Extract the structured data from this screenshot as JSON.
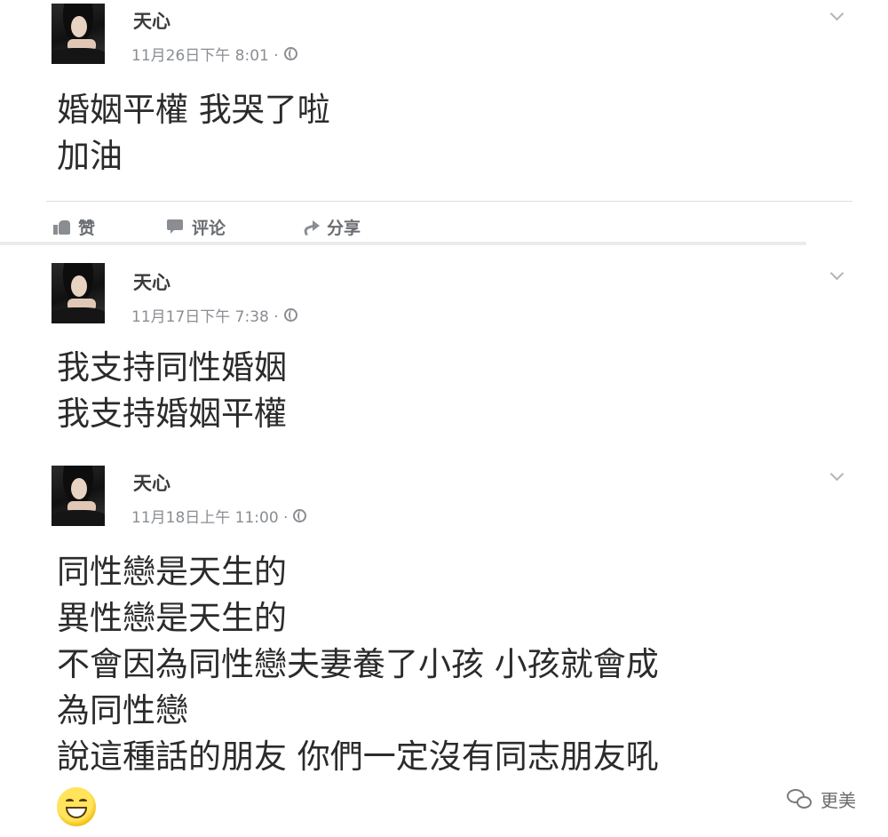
{
  "posts": [
    {
      "author": "天心",
      "timestamp": "11月26日下午 8:01 ·",
      "lines": [
        "婚姻平權 我哭了啦",
        "加油"
      ],
      "actions": {
        "like": "赞",
        "comment": "评论",
        "share": "分享"
      }
    },
    {
      "author": "天心",
      "timestamp": "11月17日下午 7:38 ·",
      "lines": [
        "我支持同性婚姻",
        "我支持婚姻平權"
      ]
    },
    {
      "author": "天心",
      "timestamp": "11月18日上午 11:00 ·",
      "lines": [
        "同性戀是天生的",
        "異性戀是天生的",
        "不會因為同性戀夫妻養了小孩 小孩就會成",
        "為同性戀",
        "說這種話的朋友 你們一定沒有同志朋友吼"
      ]
    }
  ],
  "watermark": {
    "text": "更美",
    "icon": "wechat-icon"
  },
  "icons": {
    "privacy": "globe-icon",
    "menu": "chevron-down-icon",
    "like": "thumbs-up-icon",
    "comment": "comment-icon",
    "share": "share-arrow-icon",
    "emoji": "grinning-face-emoji"
  },
  "colors": {
    "text": "#2b2b2b",
    "meta": "#8a8d91",
    "divider": "#dddfe2",
    "separator": "#e9ebee"
  }
}
